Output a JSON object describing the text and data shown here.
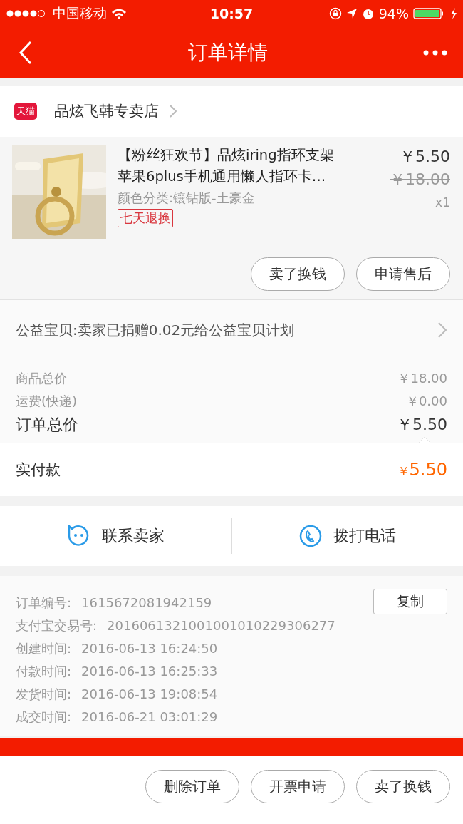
{
  "status_bar": {
    "carrier": "中国移动",
    "time": "10:57",
    "battery": "94%"
  },
  "nav": {
    "title": "订单详情"
  },
  "shop": {
    "name": "品炫飞韩专卖店",
    "badge": "天猫"
  },
  "product": {
    "title_line1": "【粉丝狂欢节】品炫iring指环支架",
    "title_line2": "苹果6plus手机通用懒人指环卡…",
    "variant": "颜色分类:镶钻版-土豪金",
    "tag": "七天退换",
    "price": "￥5.50",
    "original_price": "￥18.00",
    "quantity": "x1",
    "image": {
      "kind": "picture"
    },
    "buttons": [
      "卖了换钱",
      "申请售后"
    ]
  },
  "charity": {
    "text": "公益宝贝:卖家已捐赠0.02元给公益宝贝计划"
  },
  "summary": [
    {
      "label": "商品总价",
      "value": "￥18.00",
      "kind": "minor"
    },
    {
      "label": "运费(快递)",
      "value": "￥0.00",
      "kind": "minor"
    },
    {
      "label": "订单总价",
      "value": "￥5.50",
      "kind": "major"
    }
  ],
  "paid": {
    "label": "实付款",
    "currency": "￥",
    "amount": "5.50"
  },
  "contact": [
    {
      "label": "联系卖家",
      "kind": "chat"
    },
    {
      "label": "拨打电话",
      "kind": "phone"
    }
  ],
  "info": [
    {
      "label": "订单编号:",
      "value": "1615672081942159"
    },
    {
      "label": "支付宝交易号:",
      "value": "2016061321001001010229306277"
    },
    {
      "label": "创建时间:",
      "value": "2016-06-13 16:24:50"
    },
    {
      "label": "付款时间:",
      "value": "2016-06-13 16:25:33"
    },
    {
      "label": "发货时间:",
      "value": "2016-06-13 19:08:54"
    },
    {
      "label": "成交时间:",
      "value": "2016-06-21 03:01:29"
    }
  ],
  "copy_button": "复制",
  "bottom_buttons": [
    "删除订单",
    "开票申请",
    "卖了换钱"
  ]
}
